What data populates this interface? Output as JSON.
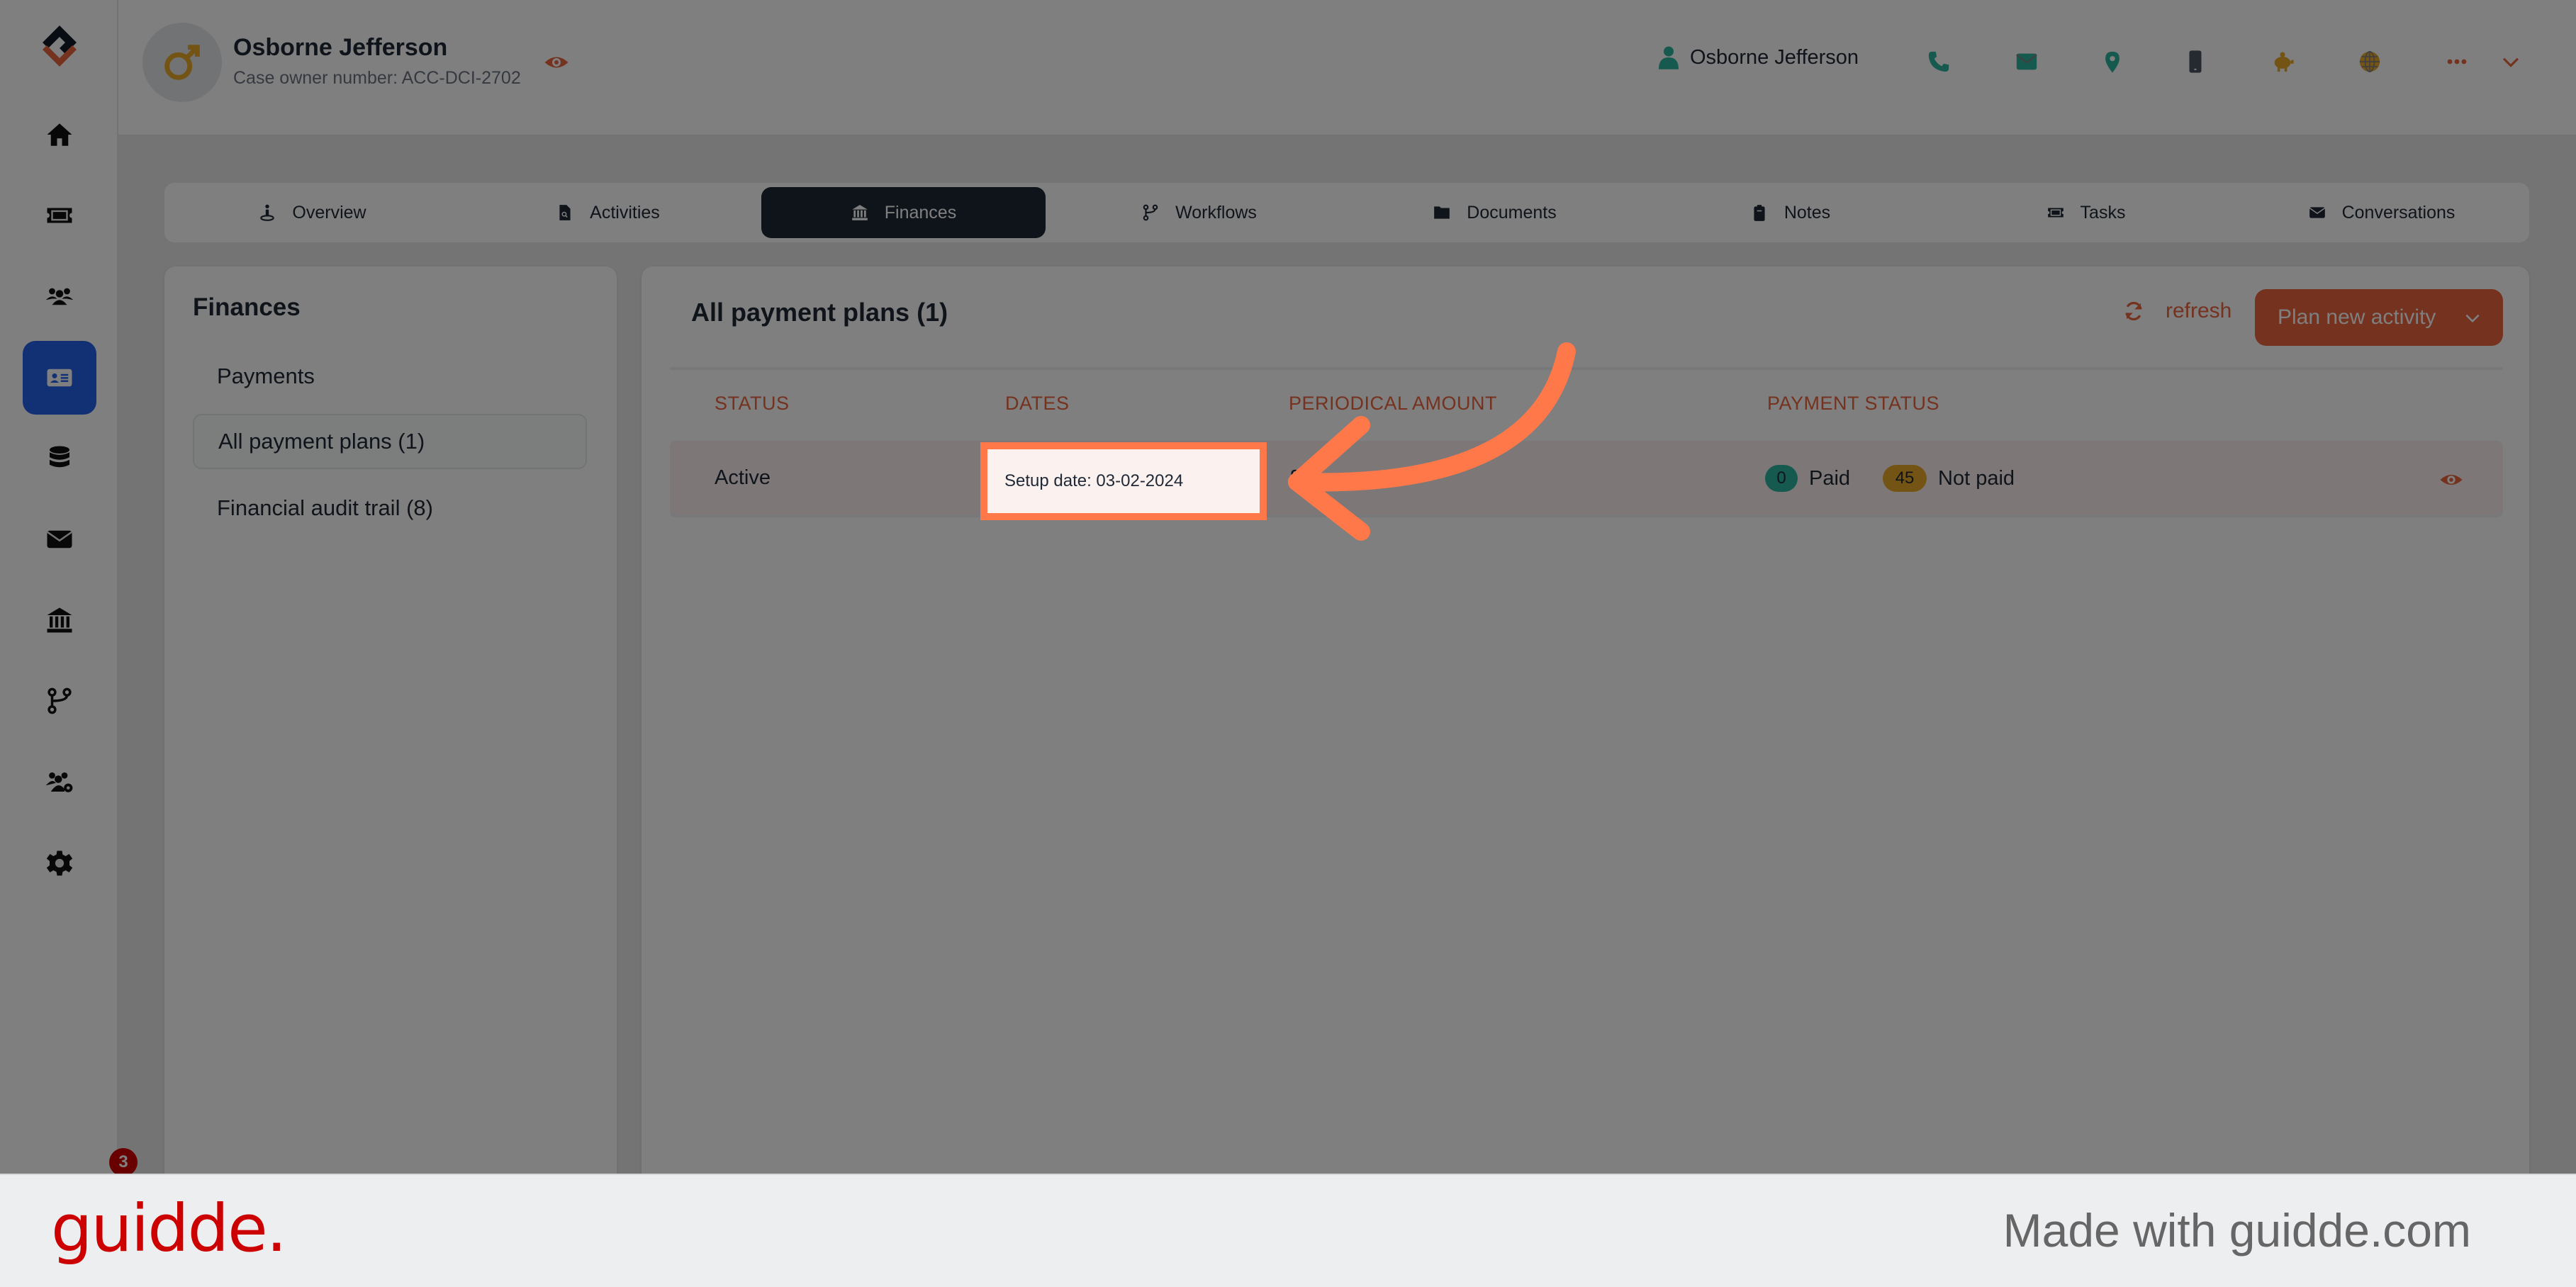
{
  "header": {
    "name": "Osborne Jefferson",
    "subtitle": "Case owner number: ACC-DCI-2702",
    "user_label": "Osborne Jefferson",
    "icons": [
      "eye-icon",
      "user-icon",
      "phone-icon",
      "envelope-icon",
      "location-pin-icon",
      "mobile-icon",
      "piggy-bank-icon",
      "globe-icon",
      "more-icon",
      "chevron-down-icon"
    ]
  },
  "sidebar": {
    "items": [
      {
        "icon": "home-icon"
      },
      {
        "icon": "ticket-icon"
      },
      {
        "icon": "users-icon"
      },
      {
        "icon": "id-card-icon",
        "active": true
      },
      {
        "icon": "database-icon"
      },
      {
        "icon": "envelope-icon"
      },
      {
        "icon": "bank-icon"
      },
      {
        "icon": "workflow-icon"
      },
      {
        "icon": "users-gear-icon"
      },
      {
        "icon": "gear-icon"
      }
    ],
    "notification_count": "3"
  },
  "tabs": [
    {
      "label": "Overview",
      "icon": "person-pin-icon"
    },
    {
      "label": "Activities",
      "icon": "file-search-icon"
    },
    {
      "label": "Finances",
      "icon": "bank-icon",
      "active": true
    },
    {
      "label": "Workflows",
      "icon": "workflow-icon"
    },
    {
      "label": "Documents",
      "icon": "folder-icon"
    },
    {
      "label": "Notes",
      "icon": "clipboard-icon"
    },
    {
      "label": "Tasks",
      "icon": "ticket-icon"
    },
    {
      "label": "Conversations",
      "icon": "envelope-icon"
    }
  ],
  "finances_menu": {
    "title": "Finances",
    "items": [
      {
        "label": "Payments"
      },
      {
        "label": "All payment plans (1)",
        "active": true
      },
      {
        "label": "Financial audit trail (8)"
      }
    ]
  },
  "payment_plans": {
    "title": "All payment plans (1)",
    "refresh_label": "refresh",
    "plan_button_label": "Plan new activity",
    "columns": [
      "STATUS",
      "DATES",
      "PERIODICAL AMOUNT",
      "PAYMENT STATUS"
    ],
    "rows": [
      {
        "status": "Active",
        "dates": "Setup date: 03-02-2024",
        "amount": "£",
        "paid_count": "0",
        "paid_label": "Paid",
        "not_paid_count": "45",
        "not_paid_label": "Not paid"
      }
    ]
  },
  "colors": {
    "accent": "#e8643f",
    "active_nav": "#2563eb",
    "active_tab": "#1f2937",
    "paid_badge": "#2ab39e",
    "not_paid_badge": "#e9a829",
    "highlight": "#ff7849"
  },
  "footer": {
    "brand": "guidde.",
    "made_with": "Made with guidde.com"
  }
}
